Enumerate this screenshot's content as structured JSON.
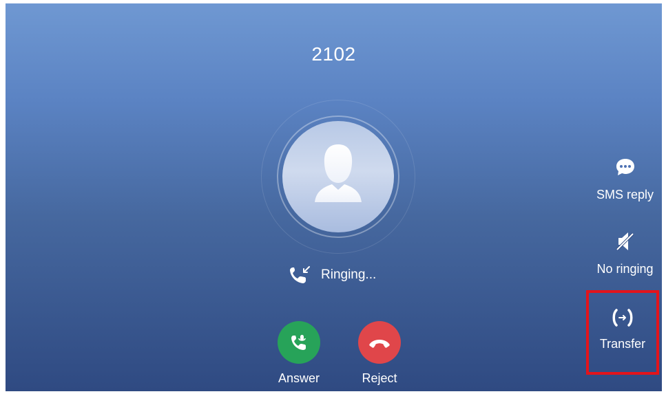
{
  "call": {
    "caller_number": "2102",
    "status": "Ringing..."
  },
  "actions": {
    "answer_label": "Answer",
    "reject_label": "Reject"
  },
  "side_actions": {
    "sms_reply_label": "SMS reply",
    "no_ringing_label": "No ringing",
    "transfer_label": "Transfer"
  },
  "icons": {
    "avatar": "person-silhouette-icon",
    "status": "incoming-call-icon",
    "answer": "phone-answer-icon",
    "reject": "phone-hangup-icon",
    "sms": "chat-bubble-icon",
    "no_ringing": "speaker-mute-icon",
    "transfer": "call-transfer-icon"
  },
  "colors": {
    "answer": "#27a359",
    "reject": "#e0464a",
    "highlight": "#e3141b",
    "background_top": "#6f98d2",
    "background_bottom": "#2f4a82"
  }
}
